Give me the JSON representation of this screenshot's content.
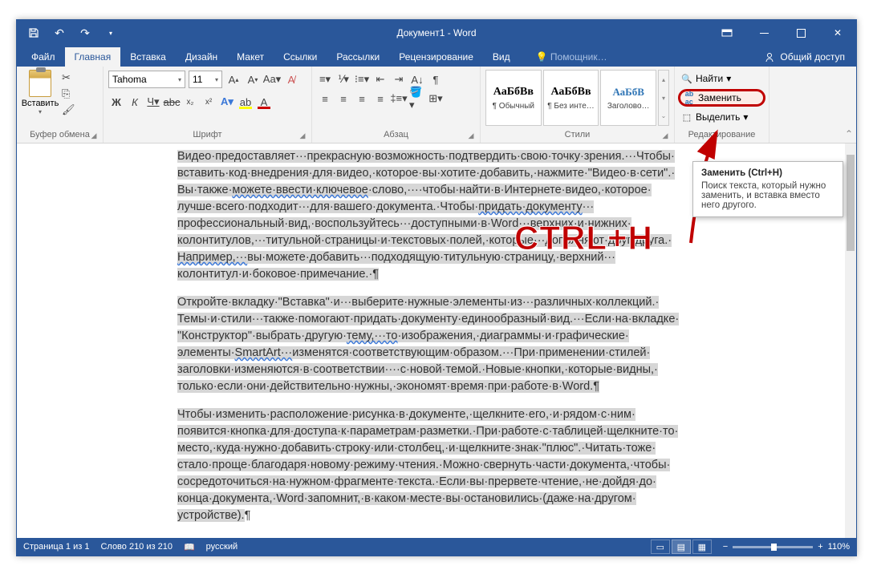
{
  "title": "Документ1 - Word",
  "tabs": {
    "file": "Файл",
    "home": "Главная",
    "insert": "Вставка",
    "design": "Дизайн",
    "layout": "Макет",
    "references": "Ссылки",
    "mailings": "Рассылки",
    "review": "Рецензирование",
    "view": "Вид",
    "tell": "Помощник…"
  },
  "share": "Общий доступ",
  "groups": {
    "clipboard": "Буфер обмена",
    "font": "Шрифт",
    "paragraph": "Абзац",
    "styles": "Стили",
    "editing": "Редактирование"
  },
  "clipboard": {
    "paste": "Вставить"
  },
  "font": {
    "name": "Tahoma",
    "size": "11"
  },
  "styles": {
    "s1_sample": "АаБбВв",
    "s1_label": "¶ Обычный",
    "s2_sample": "АаБбВв",
    "s2_label": "¶ Без инте…",
    "s3_sample": "АаБбВ",
    "s3_label": "Заголово…"
  },
  "editing": {
    "find": "Найти",
    "replace": "Заменить",
    "select": "Выделить"
  },
  "tooltip": {
    "title": "Заменить (Ctrl+H)",
    "body": "Поиск текста, который нужно заменить, и вставка вместо него другого."
  },
  "overlay": "CTRL+H",
  "doc": {
    "p1a": "Видео·предоставляет···прекрасную·возможность·подтвердить·свою·точку·зрения.···Чтобы·",
    "p1b": "вставить·код·внедрения·для·видео,·которое·вы·хотите·добавить,·нажмите·\"Видео·в·сети\".·",
    "p1c": "Вы·также·",
    "p1c_wavy": "можете·ввести·ключевое",
    "p1c_end": "·слово,····чтобы·найти·в·Интернете·видео,·которое·",
    "p1d": "лучше·всего·подходит···для·вашего·документа.·Чтобы·",
    "p1d_wavy": "придать·документу",
    "p1d_end": "···",
    "p1e": "профессиональный·вид,·воспользуйтесь···доступными·в·Word···верхних·и·нижних·",
    "p1f": "колонтитулов,···титульной·страницы·и·текстовых·полей,·которые···дополняют·друг·друга.·",
    "p1g_wavy": "Например,···",
    "p1g": "вы·можете·добавить···подходящую·титульную·страницу,·верхний···",
    "p1h": "колонтитул·и·боковое·примечание.·¶",
    "p2a": "Откройте·вкладку·\"Вставка\"·и···выберите·нужные·элементы·из···различных·коллекций.·",
    "p2b": "Темы·и·стили···также·помогают·придать·документу·единообразный·вид.···Если·на·вкладке·",
    "p2c": "\"Конструктор\"·выбрать·другую·",
    "p2c_wavy": "тему,···то",
    "p2c_end": "·изображения,·диаграммы·и·графические·",
    "p2d": "элементы·",
    "p2d_wavy": "SmartArt···",
    "p2d_end": "изменятся·соответствующим·образом.···При·применении·стилей·",
    "p2e": "заголовки·изменяются·в·соответствии····с·новой·темой.·Новые·кнопки,·которые·видны,·",
    "p2f": "только·если·они·действительно·нужны,·экономят·время·при·работе·в·Word.¶",
    "p3a": "Чтобы·изменить·расположение·рисунка·в·документе,·щелкните·его,·и·рядом·с·ним·",
    "p3b": "появится·кнопка·для·доступа·к·параметрам·разметки.·При·работе·с·таблицей·щелкните·то·",
    "p3c": "место,·куда·нужно·добавить·строку·или·столбец,·и·щелкните·знак·\"плюс\".·Читать·тоже·",
    "p3d": "стало·проще·благодаря·новому·режиму·чтения.·Можно·свернуть·части·документа,·чтобы·",
    "p3e": "сосредоточиться·на·нужном·фрагменте·текста.·Если·вы·прервете·чтение,·не·дойдя·до·",
    "p3f": "конца·документа,·Word·запомнит,·в·каком·месте·вы·остановились·(даже·на·другом·",
    "p3g": "устройстве).",
    "p3g_end": "¶"
  },
  "status": {
    "page": "Страница 1 из 1",
    "words": "Слово 210 из 210",
    "lang": "русский",
    "zoom": "110%"
  }
}
